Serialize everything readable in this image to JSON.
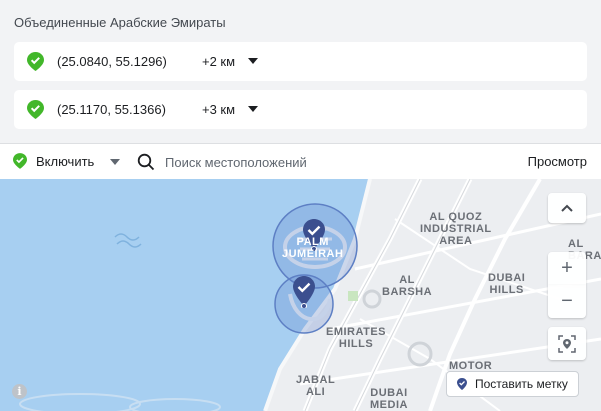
{
  "header": {
    "country": "Объединенные Арабские Эмираты"
  },
  "locations": [
    {
      "coords": "(25.0840, 55.1296)",
      "radius": "+2 км",
      "status": "included"
    },
    {
      "coords": "(25.1170, 55.1366)",
      "radius": "+3 км",
      "status": "included"
    }
  ],
  "toolbar": {
    "include_label": "Включить",
    "search_placeholder": "Поиск местоположений",
    "preview_label": "Просмотр"
  },
  "map": {
    "labels": {
      "al_quoz": "AL QUOZ\nINDUSTRIAL\nAREA",
      "al_barsha": "AL\nBARSHA",
      "al_barari": "AL\nBARAR",
      "dubai_hills": "DUBAI\nHILLS",
      "emirates_hills": "EMIRATES\nHILLS",
      "jabal_ali": "JABAL\nALI",
      "dubai_media": "DUBAI\nMEDIA",
      "motor": "MOTOR",
      "palm_jumeirah": "PALM\nJUMEIRAH"
    },
    "set_pin_label": "Поставить метку",
    "zoom_in": "+",
    "zoom_out": "−",
    "info": "i"
  },
  "colors": {
    "accent_green": "#42b72a",
    "pin_blue": "#3b4f8f",
    "water": "#a7cff1",
    "land": "#eef0f3"
  }
}
